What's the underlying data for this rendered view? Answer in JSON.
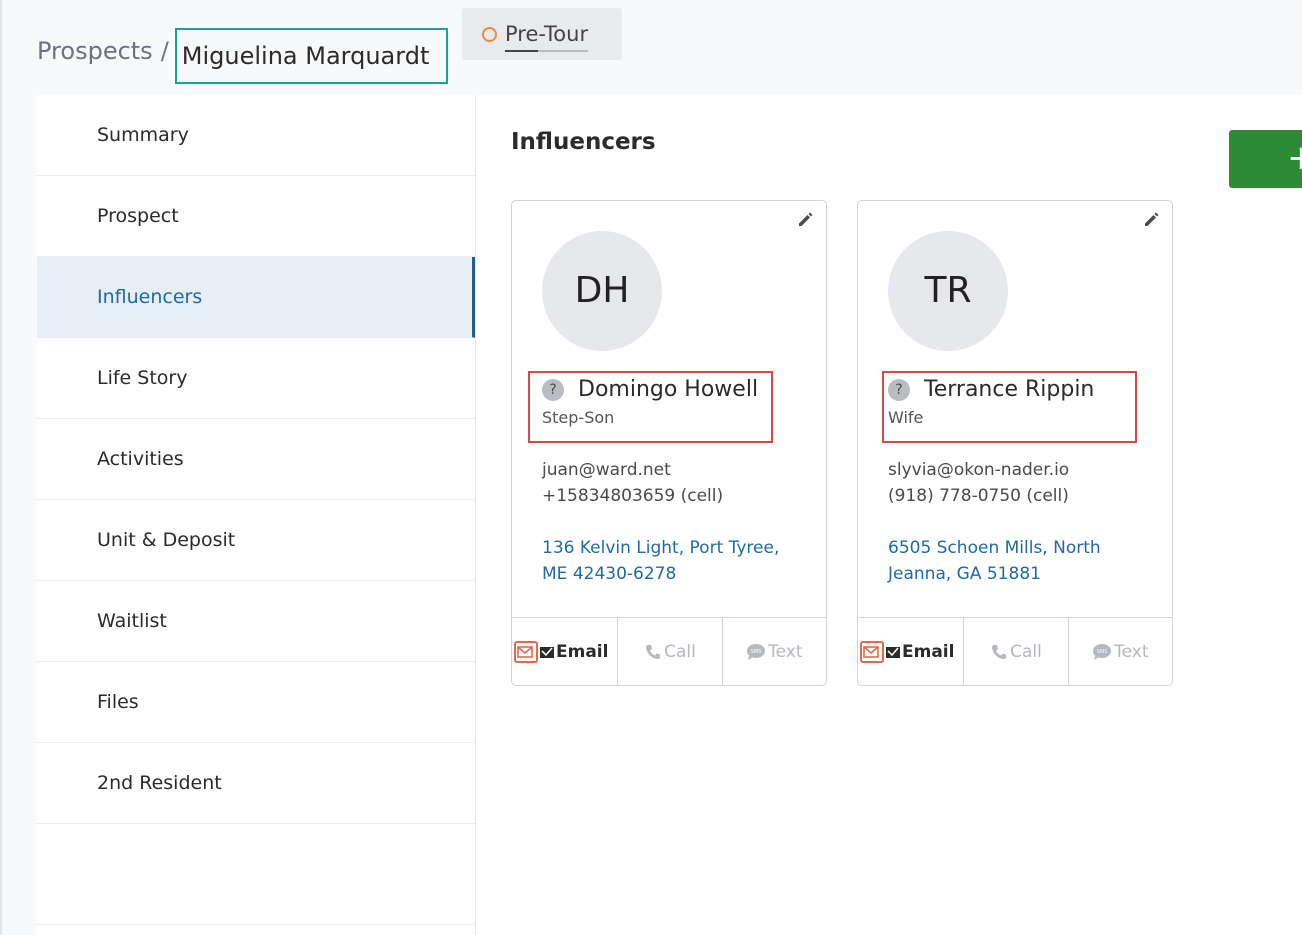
{
  "breadcrumb": {
    "root": "Prospects",
    "separator": "/",
    "current": "Miguelina Marquardt"
  },
  "status": {
    "label": "Pre-Tour",
    "dot_color": "#f08a3a"
  },
  "sidebar": {
    "items": [
      {
        "label": "Summary"
      },
      {
        "label": "Prospect"
      },
      {
        "label": "Influencers",
        "active": true
      },
      {
        "label": "Life Story"
      },
      {
        "label": "Activities"
      },
      {
        "label": "Unit & Deposit"
      },
      {
        "label": "Waitlist"
      },
      {
        "label": "Files"
      },
      {
        "label": "2nd Resident"
      }
    ]
  },
  "main": {
    "title": "Influencers",
    "add_label": "+",
    "cards": [
      {
        "initials": "DH",
        "name": "Domingo Howell",
        "relation": "Step-Son",
        "email": "juan@ward.net",
        "phone": "+15834803659 (cell)",
        "address": "136 Kelvin Light, Port Tyree, ME 42430-6278",
        "actions": {
          "email": "Email",
          "call": "Call",
          "text": "Text"
        }
      },
      {
        "initials": "TR",
        "name": "Terrance Rippin",
        "relation": "Wife",
        "email": "slyvia@okon-nader.io",
        "phone": "(918) 778-0750 (cell)",
        "address": "6505 Schoen Mills, North Jeanna, GA 51881",
        "actions": {
          "email": "Email",
          "call": "Call",
          "text": "Text"
        }
      }
    ]
  },
  "colors": {
    "accent": "#1f6aa5",
    "add_button": "#2e8b35",
    "highlight_green": "#1aa58a",
    "highlight_red": "#d84848"
  }
}
